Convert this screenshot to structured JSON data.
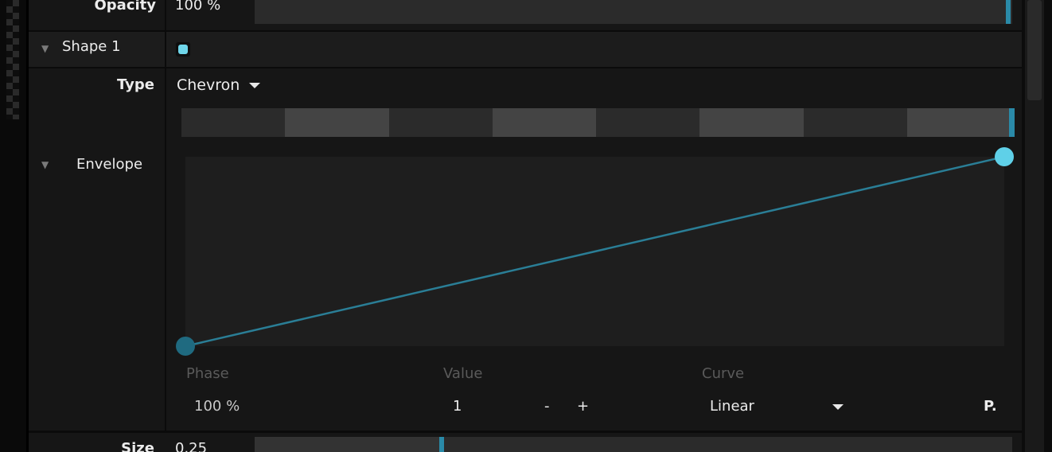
{
  "opacity": {
    "label": "Opacity",
    "value": "100 %",
    "level": 1.0
  },
  "shape": {
    "label": "Shape 1",
    "enabled": true,
    "color": "#6fd6ea"
  },
  "type": {
    "label": "Type",
    "value": "Chevron"
  },
  "preview": {
    "segments": [
      "#2b2b2b",
      "#444444",
      "#2b2b2b",
      "#444444",
      "#2b2b2b",
      "#444444",
      "#2b2b2b",
      "#444444"
    ],
    "accent": "#2a8aa8"
  },
  "envelope": {
    "label": "Envelope",
    "phase_label": "Phase",
    "value_label": "Value",
    "curve_label": "Curve",
    "phase": "100 %",
    "value": "1",
    "minus": "-",
    "plus": "+",
    "curve": "Linear",
    "presets": "P.",
    "points": [
      {
        "phase": 0,
        "value": 0
      },
      {
        "phase": 1,
        "value": 1
      }
    ],
    "line_color": "#2a7e96",
    "point_color": "#5fd0e8"
  },
  "size": {
    "label": "Size",
    "value": "0.25",
    "level": 0.25
  },
  "icons": {
    "collapse": "triangle-down-icon",
    "dropdown": "caret-down-icon"
  }
}
